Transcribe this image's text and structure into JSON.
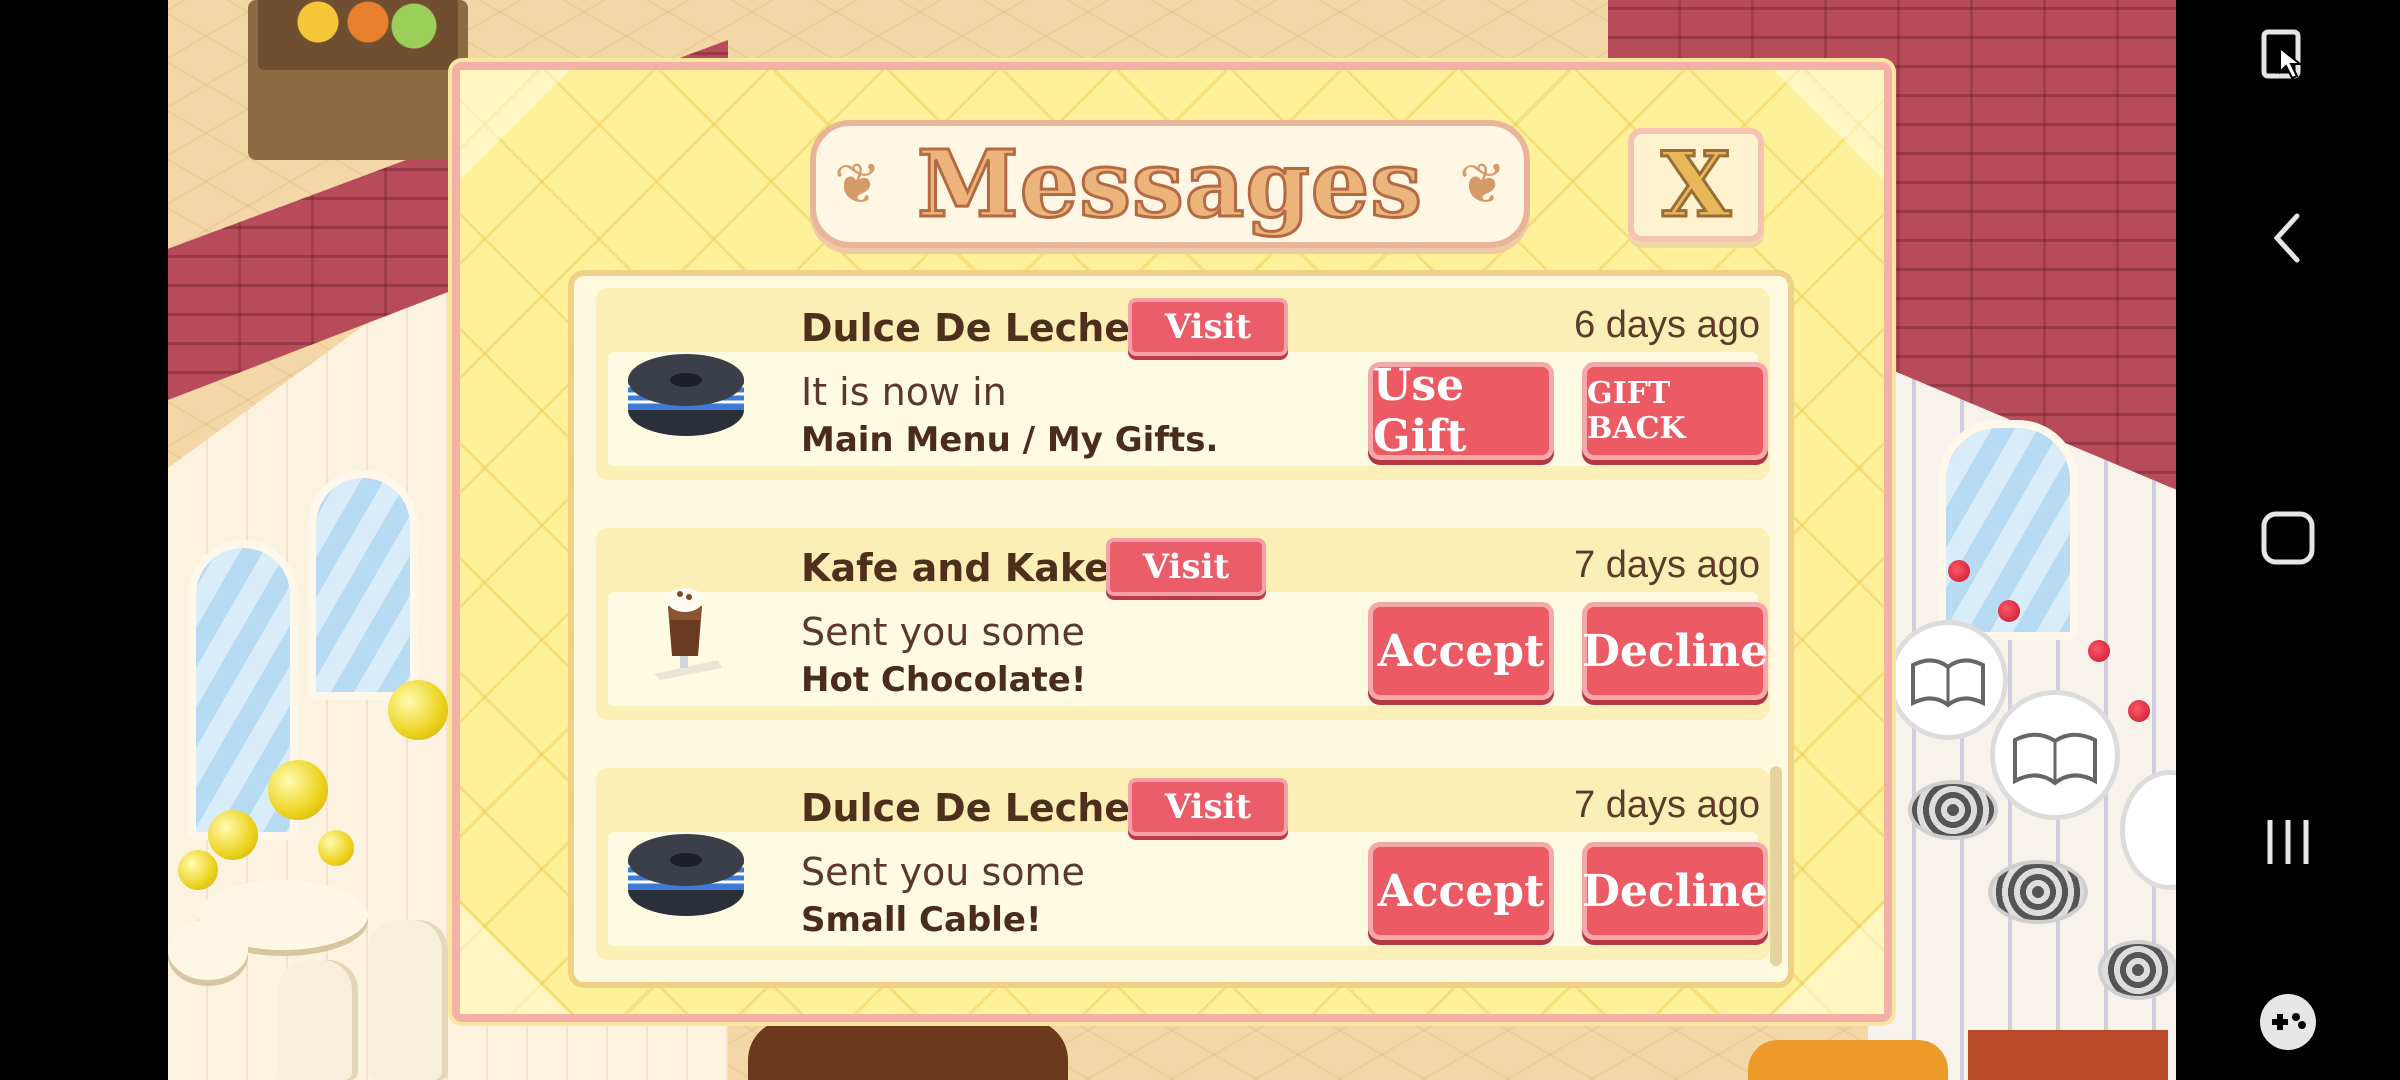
{
  "dialog": {
    "title": "Messages",
    "close_label": "X"
  },
  "messages": [
    {
      "sender": "Dulce De Leche",
      "visit_label": "Visit",
      "time": "6 days ago",
      "line1": "It is now in",
      "line2": "Main Menu / My Gifts.",
      "item_icon": "cable-spool-icon",
      "buttons": [
        "Use Gift",
        "GIFT BACK"
      ]
    },
    {
      "sender": "Kafe and Kake",
      "visit_label": "Visit",
      "time": "7 days ago",
      "line1": "Sent you some",
      "line2": "Hot Chocolate!",
      "item_icon": "hot-chocolate-icon",
      "buttons": [
        "Accept",
        "Decline"
      ]
    },
    {
      "sender": "Dulce De Leche",
      "visit_label": "Visit",
      "time": "7 days ago",
      "line1": "Sent you some",
      "line2": "Small Cable!",
      "item_icon": "cable-spool-icon",
      "buttons": [
        "Accept",
        "Decline"
      ]
    }
  ],
  "navbar": {
    "icons": [
      "screen-pin-icon",
      "back-icon",
      "home-icon",
      "recents-icon",
      "game-tools-icon"
    ]
  },
  "colors": {
    "dialog_bg": "#fff199",
    "button_red": "#ec5a64",
    "dialog_border": "#f3b1a8"
  }
}
